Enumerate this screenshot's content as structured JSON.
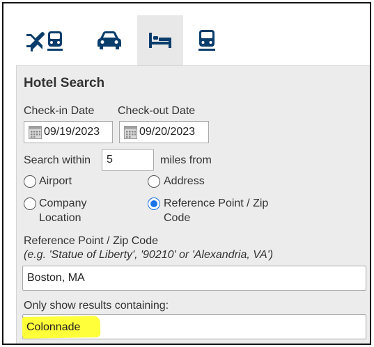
{
  "tabs": [
    {
      "icon": "flight-train-icon",
      "active": false
    },
    {
      "icon": "car-icon",
      "active": false
    },
    {
      "icon": "hotel-bed-icon",
      "active": true
    },
    {
      "icon": "train-icon",
      "active": false
    }
  ],
  "panel": {
    "heading": "Hotel Search",
    "checkin_label": "Check-in Date",
    "checkout_label": "Check-out Date",
    "checkin_value": "09/19/2023",
    "checkout_value": "09/20/2023",
    "search_within_label": "Search within",
    "search_within_value": "5",
    "miles_from_label": "miles from",
    "options": [
      {
        "label_line1": "Airport",
        "label_line2": "",
        "checked": false
      },
      {
        "label_line1": "Address",
        "label_line2": "",
        "checked": false
      },
      {
        "label_line1": "Company",
        "label_line2": "Location",
        "checked": false
      },
      {
        "label_line1": "Reference Point / Zip",
        "label_line2": "Code",
        "checked": true
      }
    ],
    "ref_point_label": "Reference Point / Zip Code",
    "ref_point_hint": "(e.g. 'Statue of Liberty', '90210' or 'Alexandria, VA')",
    "ref_point_value": "Boston, MA",
    "filter_label": "Only show results containing:",
    "filter_value": "Colonnade"
  },
  "colors": {
    "icon": "#0a3d6b",
    "panel_bg": "#ececec",
    "radio_selected": "#1a73e8",
    "highlight": "#ffff3a"
  }
}
